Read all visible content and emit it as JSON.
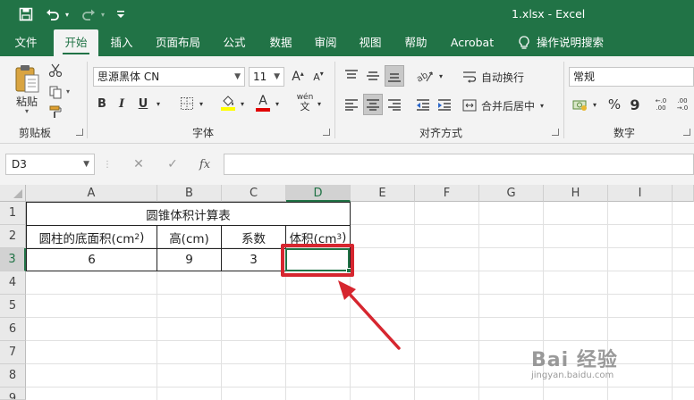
{
  "titlebar": {
    "save_icon": "save-icon",
    "undo_icon": "undo-icon",
    "redo_icon": "redo-icon",
    "customize_icon": "customize-qat-icon",
    "title": "1.xlsx  -  Excel"
  },
  "tabs": [
    "文件",
    "开始",
    "插入",
    "页面布局",
    "公式",
    "数据",
    "审阅",
    "视图",
    "帮助",
    "Acrobat",
    "操作说明搜索"
  ],
  "active_tab": "开始",
  "ribbon": {
    "clipboard": {
      "paste_label": "粘贴",
      "group_label": "剪贴板"
    },
    "font": {
      "font_name": "思源黑体 CN",
      "font_size": "11",
      "grow": "A",
      "shrink": "A",
      "bold": "B",
      "italic": "I",
      "underline": "U",
      "font_color_letter": "A",
      "phonetic": "wén",
      "group_label": "字体"
    },
    "alignment": {
      "wrap_text": "自动换行",
      "merge_center": "合并后居中",
      "group_label": "对齐方式"
    },
    "number": {
      "format": "常规",
      "percent": "%",
      "comma": "9",
      "inc_decimal": "←.0 .00",
      "dec_decimal": ".00 →.0",
      "group_label": "数字"
    }
  },
  "formula_bar": {
    "name_box": "D3",
    "cancel": "✕",
    "enter": "✓",
    "fx": "fx",
    "formula": ""
  },
  "sheet": {
    "columns": [
      "A",
      "B",
      "C",
      "D",
      "E",
      "F",
      "G",
      "H",
      "I"
    ],
    "rows": [
      "1",
      "2",
      "3",
      "4",
      "5",
      "6",
      "7",
      "8",
      "9"
    ],
    "selected_cell": "D3",
    "cells": {
      "title": "圆锥体积计算表",
      "A2": "圆柱的底面积(cm",
      "A2_sup": "2",
      "A2_close": ")",
      "B2": "高(cm)",
      "C2": "系数",
      "D2": "体积(cm",
      "D2_sup": "3",
      "D2_close": ")",
      "A3": "6",
      "B3": "9",
      "C3": "3",
      "D3": ""
    }
  },
  "annotation": {
    "highlight_color": "#d6262f"
  },
  "watermark": {
    "main": "Bai 经验",
    "sub": "jingyan.baidu.com"
  },
  "colors": {
    "excel_green": "#217346",
    "ribbon_bg": "#f3f3f3"
  }
}
